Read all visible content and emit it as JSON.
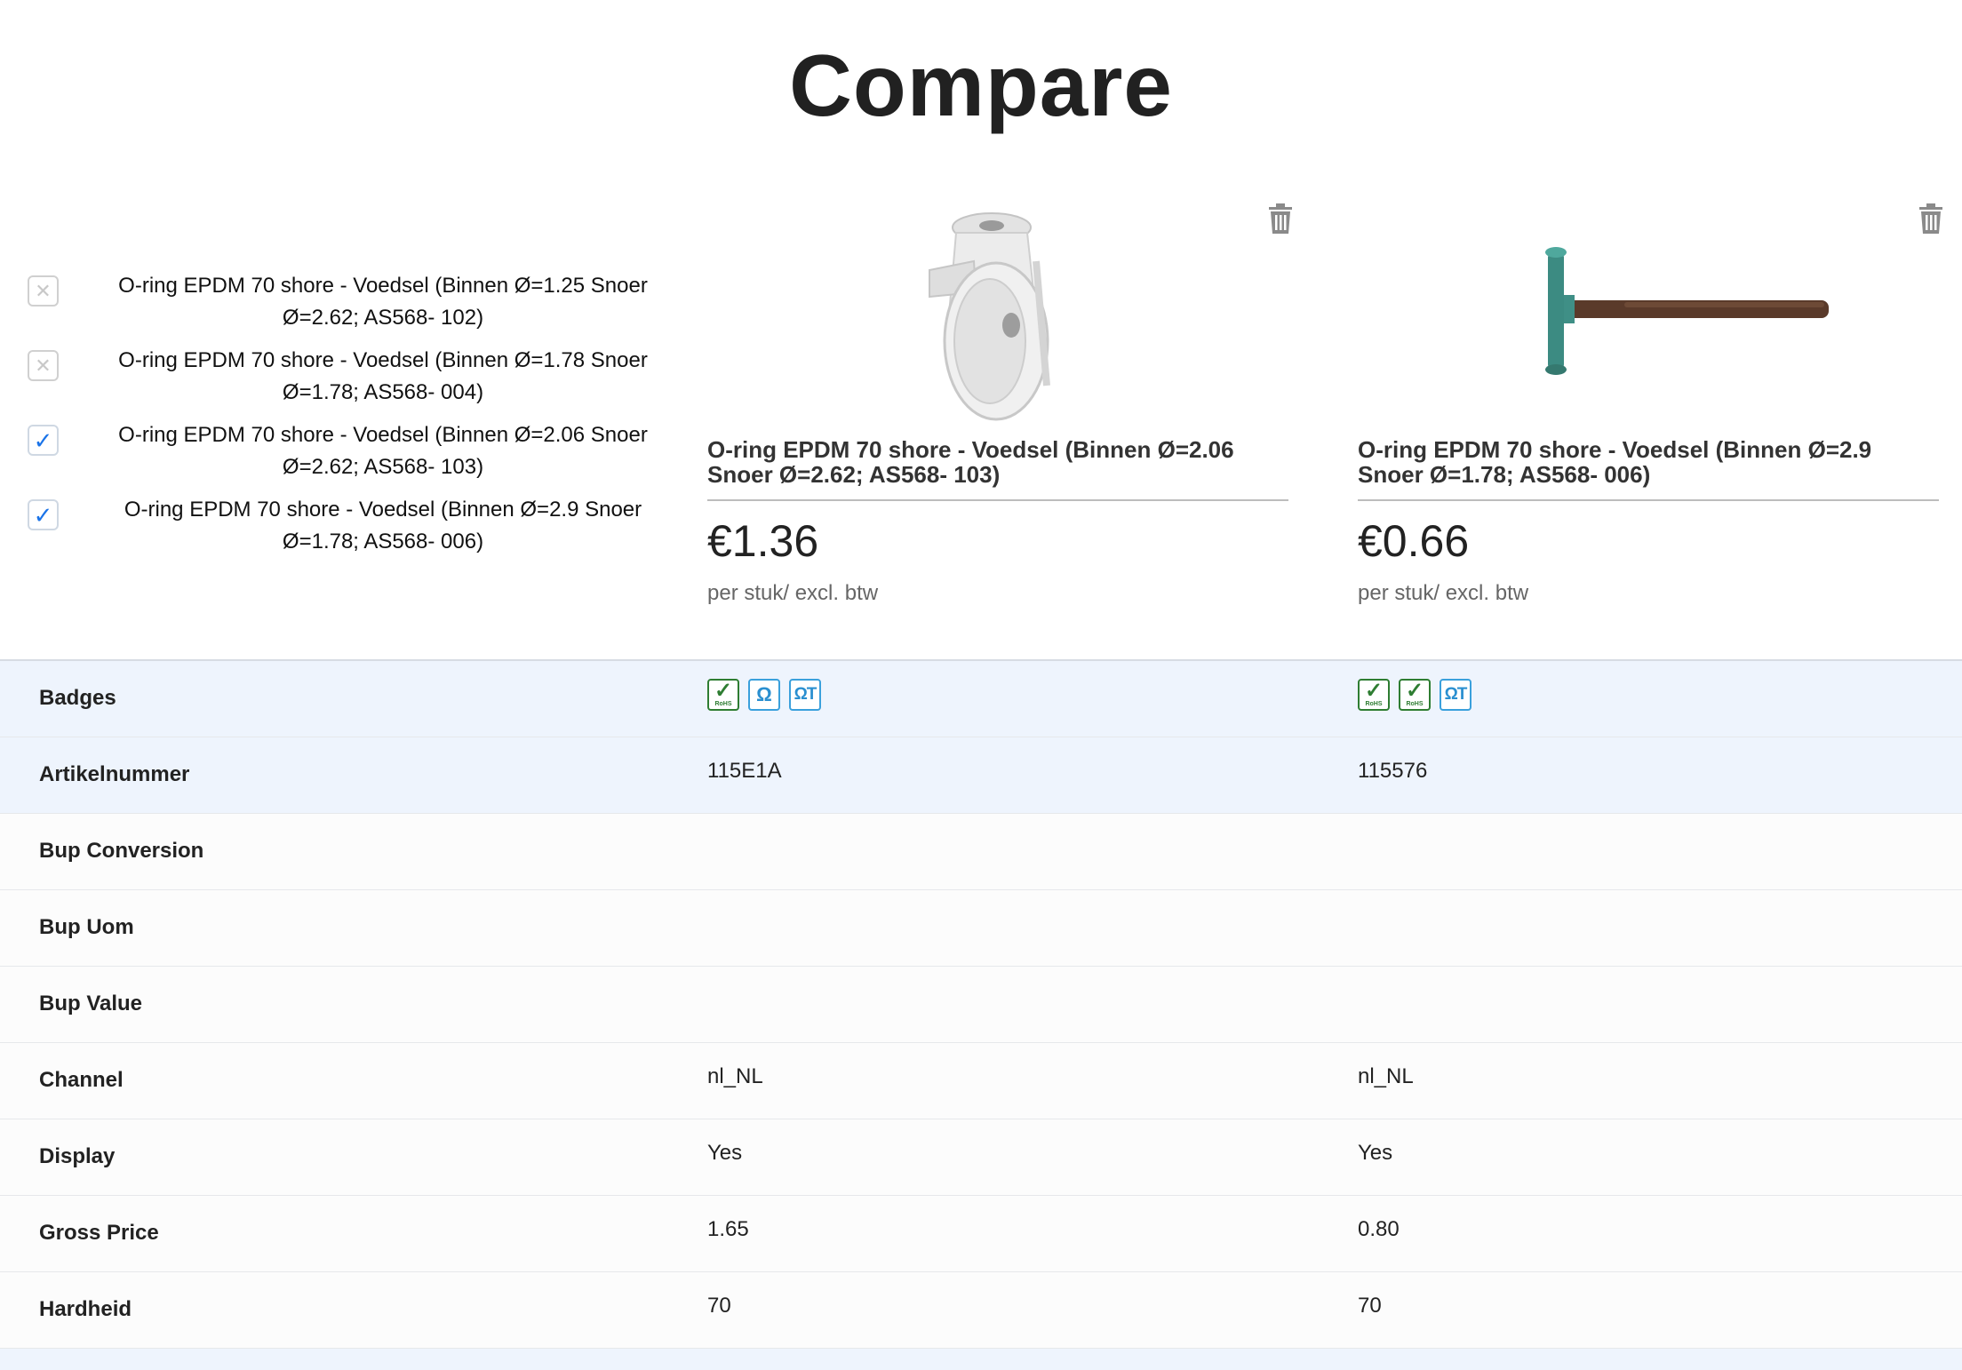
{
  "page": {
    "title": "Compare"
  },
  "selector": {
    "items": [
      {
        "label": "O-ring EPDM 70 shore - Voedsel (Binnen Ø=1.25 Snoer Ø=2.62; AS568- 102)",
        "checked": false
      },
      {
        "label": "O-ring EPDM 70 shore - Voedsel (Binnen Ø=1.78 Snoer Ø=1.78; AS568- 004)",
        "checked": false
      },
      {
        "label": "O-ring EPDM 70 shore - Voedsel (Binnen Ø=2.06 Snoer Ø=2.62; AS568- 103)",
        "checked": true
      },
      {
        "label": "O-ring EPDM 70 shore - Voedsel (Binnen Ø=2.9 Snoer Ø=1.78; AS568- 006)",
        "checked": true
      }
    ]
  },
  "products": [
    {
      "name": "O-ring EPDM 70 shore - Voedsel (Binnen Ø=2.06 Snoer Ø=2.62; AS568- 103)",
      "price": "€1.36",
      "price_note": "per stuk/ excl. btw",
      "image": "castor-wheel",
      "badges": [
        "rohs",
        "omega",
        "omega-t"
      ]
    },
    {
      "name": "O-ring EPDM 70 shore - Voedsel (Binnen Ø=2.9 Snoer Ø=1.78; AS568- 006)",
      "price": "€0.66",
      "price_note": "per stuk/ excl. btw",
      "image": "hammer",
      "badges": [
        "rohs",
        "rohs",
        "omega-t"
      ]
    }
  ],
  "badge_text": {
    "rohs": "RoHS",
    "omega": "Ω",
    "omega_t": "ΩT"
  },
  "specs": [
    {
      "label": "Badges",
      "v1": "",
      "v2": ""
    },
    {
      "label": "Artikelnummer",
      "v1": "115E1A",
      "v2": "115576"
    },
    {
      "label": "Bup Conversion",
      "v1": "",
      "v2": ""
    },
    {
      "label": "Bup Uom",
      "v1": "",
      "v2": ""
    },
    {
      "label": "Bup Value",
      "v1": "",
      "v2": ""
    },
    {
      "label": "Channel",
      "v1": "nl_NL",
      "v2": "nl_NL"
    },
    {
      "label": "Display",
      "v1": "Yes",
      "v2": "Yes"
    },
    {
      "label": "Gross Price",
      "v1": "1.65",
      "v2": "0.80"
    },
    {
      "label": "Hardheid",
      "v1": "70",
      "v2": "70"
    }
  ],
  "colors": {
    "highlight_row": "#eef4fd",
    "check": "#1a73e8",
    "rohs_green": "#2e7d32",
    "omega_blue": "#2a8fd0"
  }
}
